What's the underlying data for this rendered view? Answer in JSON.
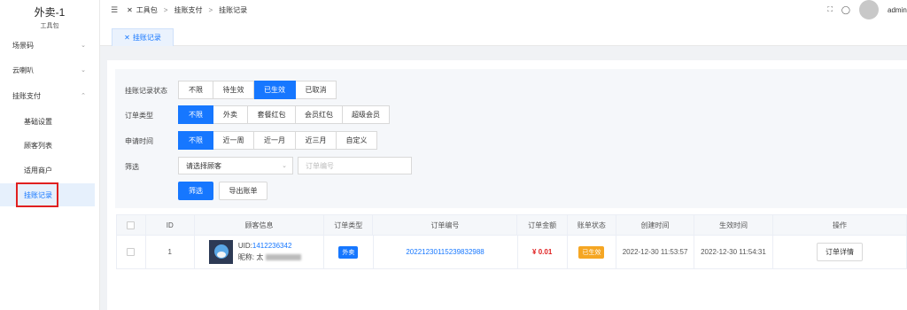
{
  "app": {
    "title": "外卖-1",
    "subtitle": "工具包"
  },
  "sidebar": {
    "items": [
      {
        "label": "场景码",
        "chevron": "chevron-down"
      },
      {
        "label": "云喇叭",
        "chevron": "chevron-down"
      },
      {
        "label": "挂账支付",
        "chevron": "chevron-up"
      }
    ],
    "sub_items": [
      {
        "label": "基础设置"
      },
      {
        "label": "顾客列表"
      },
      {
        "label": "适用商户"
      },
      {
        "label": "挂账记录",
        "active": true
      }
    ]
  },
  "header": {
    "breadcrumb": [
      "工具包",
      "挂账支付",
      "挂账记录"
    ],
    "user": "admin"
  },
  "tabs": [
    {
      "label": "挂账记录"
    }
  ],
  "filters": {
    "status": {
      "label": "挂账记录状态",
      "options": [
        "不限",
        "待生效",
        "已生效",
        "已取消"
      ],
      "selected": "已生效"
    },
    "order_type": {
      "label": "订单类型",
      "options": [
        "不限",
        "外卖",
        "套餐红包",
        "会员红包",
        "超级会员"
      ],
      "selected": "不限"
    },
    "apply_time": {
      "label": "申请时间",
      "options": [
        "不限",
        "近一周",
        "近一月",
        "近三月",
        "自定义"
      ],
      "selected": "不限"
    },
    "screen": {
      "label": "筛选",
      "select_value": "请选择顾客",
      "input_placeholder": "订单编号"
    },
    "buttons": {
      "filter": "筛选",
      "export": "导出账单"
    }
  },
  "table": {
    "columns": [
      "",
      "ID",
      "顾客信息",
      "订单类型",
      "订单编号",
      "订单金额",
      "账单状态",
      "创建时间",
      "生效时间",
      "操作"
    ],
    "rows": [
      {
        "id": "1",
        "uid_label": "UID:",
        "uid": "1412236342",
        "nickname_label": "昵称: 太",
        "order_type": "外卖",
        "order_no": "20221230115239832988",
        "amount": "¥ 0.01",
        "status": "已生效",
        "created": "2022-12-30 11:53:57",
        "effective": "2022-12-30 11:54:31",
        "action": "订单详情"
      }
    ]
  },
  "colors": {
    "primary": "#1677ff",
    "danger": "#e02020",
    "warning": "#f5a623"
  }
}
